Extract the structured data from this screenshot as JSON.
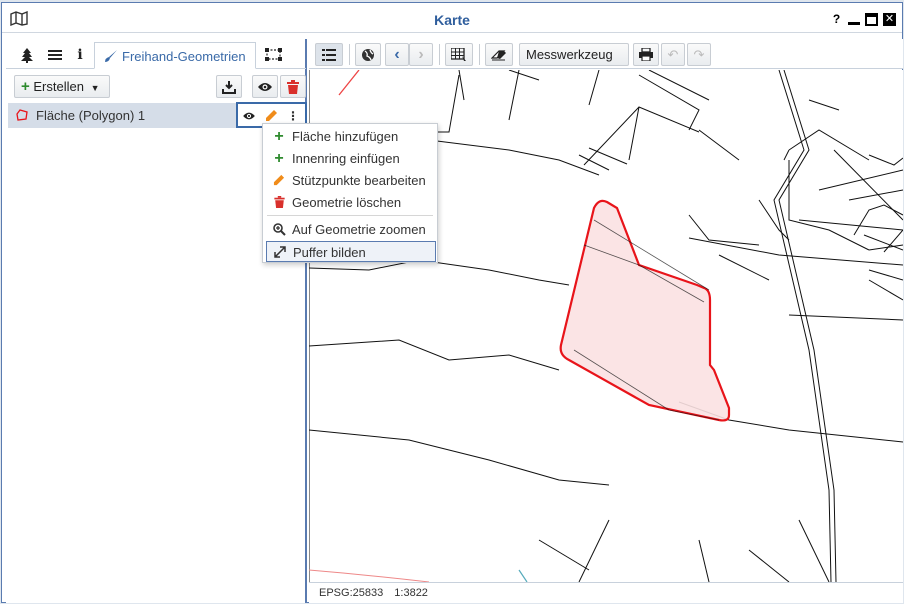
{
  "window": {
    "title": "Karte",
    "help_glyph": "?"
  },
  "left": {
    "tabs": {
      "active_label": "Freihand-Geometrien"
    },
    "toolbar": {
      "create_label": "Erstellen"
    },
    "items": [
      {
        "label": "Fläche (Polygon) 1"
      }
    ]
  },
  "context_menu": {
    "items": [
      {
        "label": "Fläche hinzufügen",
        "icon": "plus-icon",
        "color": "#2e8b2e"
      },
      {
        "label": "Innenring einfügen",
        "icon": "plus-icon",
        "color": "#2e8b2e"
      },
      {
        "label": "Stützpunkte bearbeiten",
        "icon": "pencil-icon",
        "color": "#f08c1a"
      },
      {
        "label": "Geometrie löschen",
        "icon": "trash-icon",
        "color": "#d9302c"
      },
      {
        "label": "Auf Geometrie zoomen",
        "icon": "zoom-in-icon",
        "color": "#333333"
      },
      {
        "label": "Puffer bilden",
        "icon": "expand-icon",
        "color": "#333333"
      }
    ],
    "highlighted": "Puffer bilden"
  },
  "map_toolbar": {
    "measure_label": "Messwerkzeug"
  },
  "status": {
    "epsg": "EPSG:25833",
    "scale": "1:3822"
  },
  "colors": {
    "accent": "#3a6aa8",
    "polygon_stroke": "#e8141a",
    "polygon_fill": "#fbe1e2"
  }
}
